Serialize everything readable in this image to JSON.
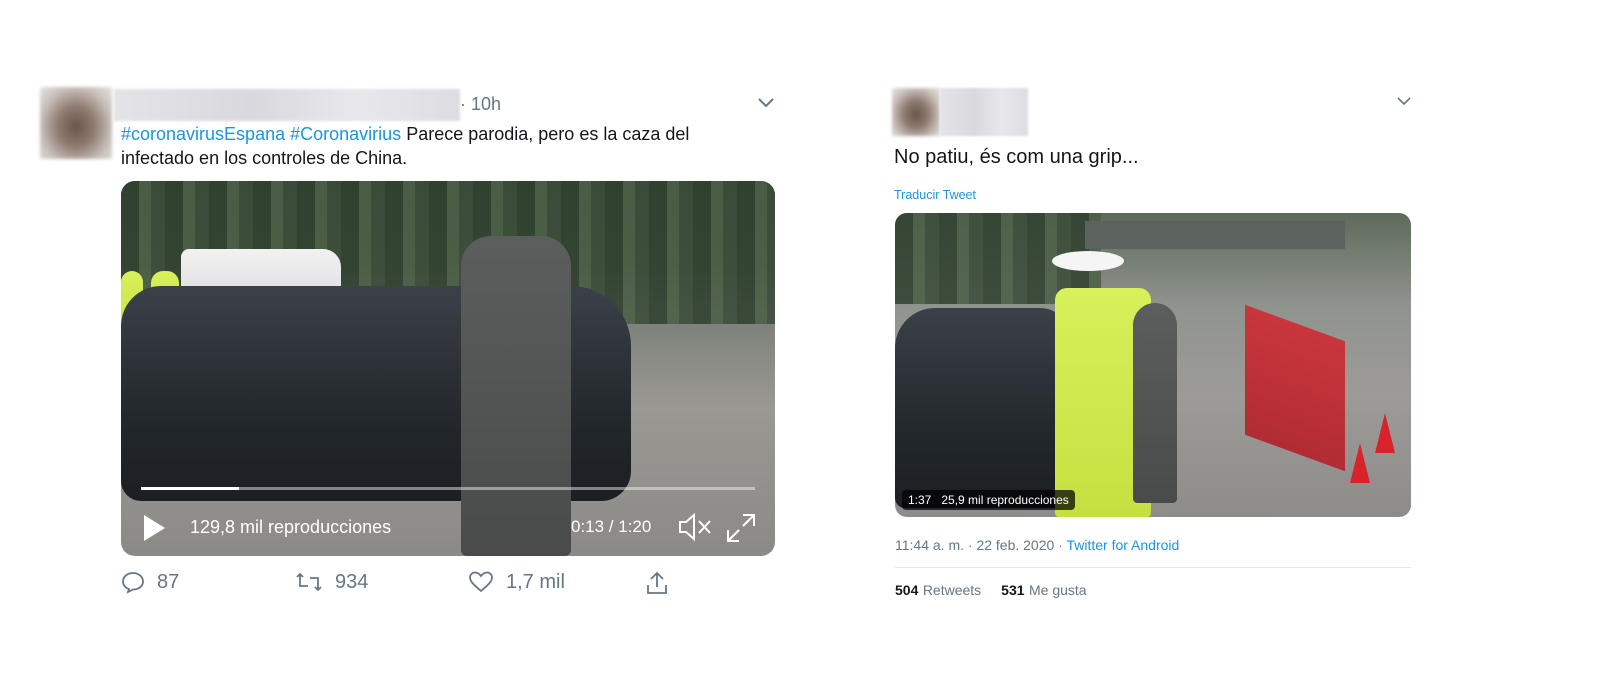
{
  "tweet1": {
    "time": "10h",
    "hashtag1": "#coronavirusEspana",
    "hashtag2": "#Coronavirius",
    "text_line1": "Parece parodia, pero es la caza del",
    "text_line2": "infectado en los controles de China.",
    "video": {
      "views": "129,8 mil reproducciones",
      "time": "0:13 / 1:20",
      "progress": 0.16
    },
    "actions": {
      "replies": "87",
      "retweets": "934",
      "likes": "1,7 mil"
    }
  },
  "tweet2": {
    "text": "No patiu, és com una grip...",
    "translate": "Traducir Tweet",
    "video": {
      "duration": "1:37",
      "views": "25,9 mil reproducciones"
    },
    "timestamp": "11:44 a. m. · 22 feb. 2020 · ",
    "client": "Twitter for Android",
    "retweets_count": "504",
    "retweets_label": "Retweets",
    "likes_count": "531",
    "likes_label": "Me gusta"
  },
  "colors": {
    "link": "#1b95e0",
    "muted": "#657786",
    "text": "#14171a"
  }
}
